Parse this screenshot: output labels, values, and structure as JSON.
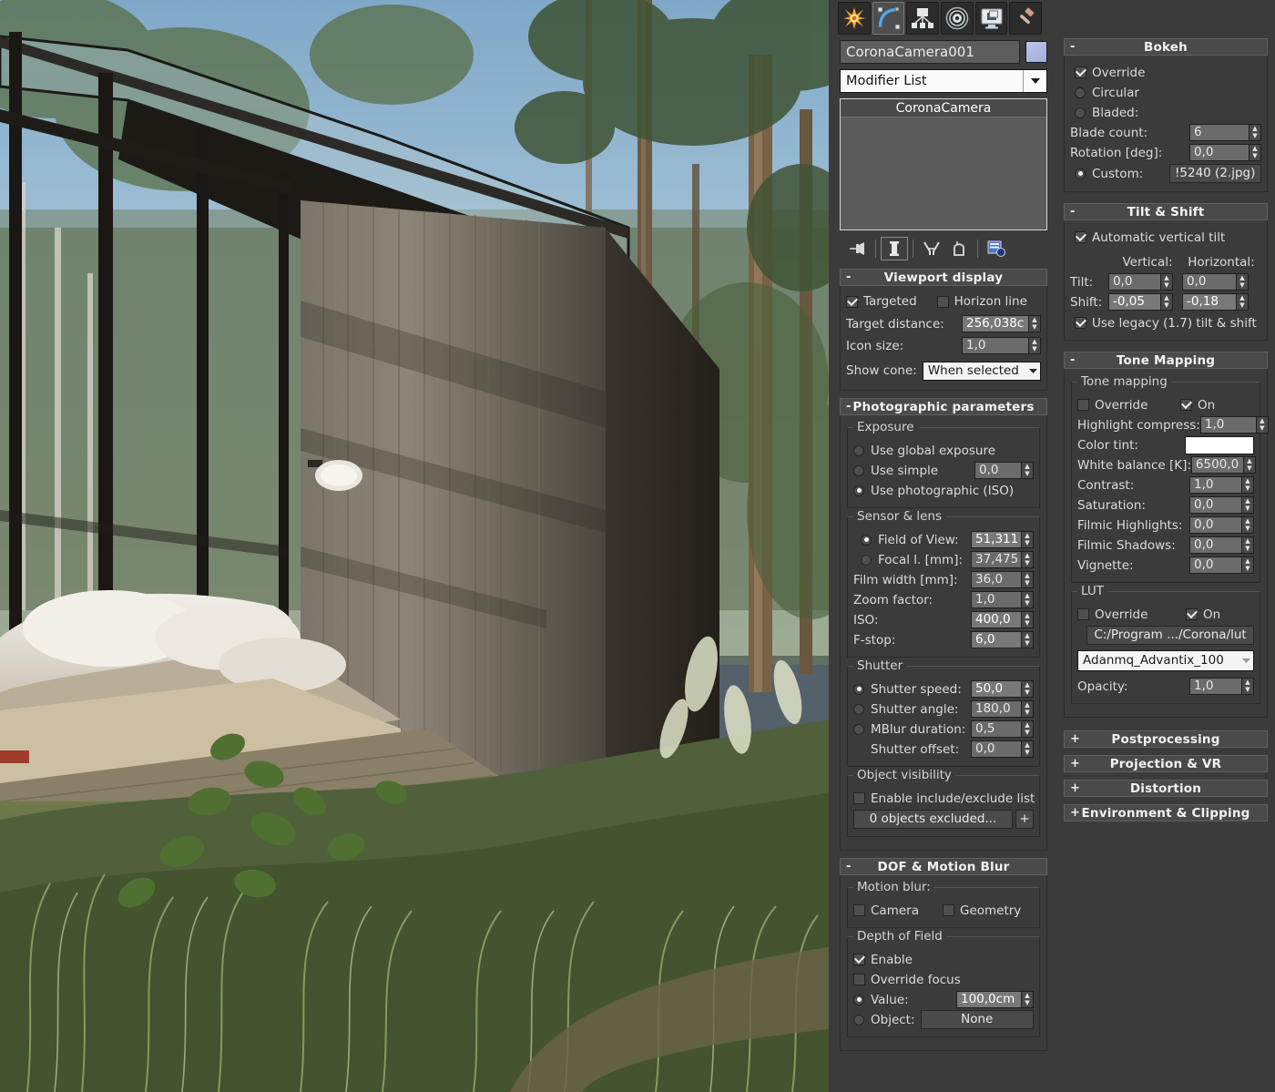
{
  "app": {
    "panel_title": "3ds Max Command Panel - Modify",
    "tabs": [
      {
        "name": "create-tab",
        "icon": "star-create-icon",
        "active": false
      },
      {
        "name": "modify-tab",
        "icon": "curve-modify-icon",
        "active": true
      },
      {
        "name": "hierarchy-tab",
        "icon": "hierarchy-icon",
        "active": false
      },
      {
        "name": "motion-tab",
        "icon": "motion-wheel-icon",
        "active": false
      },
      {
        "name": "display-tab",
        "icon": "display-monitor-icon",
        "active": false
      },
      {
        "name": "utilities-tab",
        "icon": "hammer-utilities-icon",
        "active": false
      }
    ]
  },
  "object": {
    "name_value": "CoronaCamera001",
    "modifier_list_value": "Modifier List",
    "stack_items": [
      "CoronaCamera"
    ],
    "stack_tools": [
      {
        "name": "pin-stack-icon"
      },
      {
        "name": "show-end-result-icon"
      },
      {
        "name": "make-unique-icon"
      },
      {
        "name": "remove-modifier-icon"
      },
      {
        "name": "configure-modifier-sets-icon"
      }
    ]
  },
  "viewport_display": {
    "title": "Viewport display",
    "targeted_label": "Targeted",
    "targeted_checked": true,
    "horizon_label": "Horizon line",
    "horizon_checked": false,
    "target_distance_label": "Target distance:",
    "target_distance_value": "256,038c",
    "icon_size_label": "Icon size:",
    "icon_size_value": "1,0",
    "show_cone_label": "Show cone:",
    "show_cone_value": "When selected"
  },
  "photographic": {
    "title": "Photographic parameters",
    "exposure_group": "Exposure",
    "use_global_label": "Use global exposure",
    "use_simple_label": "Use simple",
    "use_simple_value": "0,0",
    "use_photographic_label": "Use photographic (ISO)",
    "exposure_selected": "photographic",
    "sensor_group": "Sensor & lens",
    "fov_label": "Field of View:",
    "fov_value": "51,311",
    "focal_label": "Focal l. [mm]:",
    "focal_value": "37,475",
    "lens_selected": "fov",
    "film_width_label": "Film width [mm]:",
    "film_width_value": "36,0",
    "zoom_factor_label": "Zoom factor:",
    "zoom_factor_value": "1,0",
    "iso_label": "ISO:",
    "iso_value": "400,0",
    "fstop_label": "F-stop:",
    "fstop_value": "6,0",
    "shutter_group": "Shutter",
    "shutter_speed_label": "Shutter speed:",
    "shutter_speed_value": "50,0",
    "shutter_angle_label": "Shutter angle:",
    "shutter_angle_value": "180,0",
    "mblur_label": "MBlur duration:",
    "mblur_value": "0,5",
    "shutter_offset_label": "Shutter offset:",
    "shutter_offset_value": "0,0",
    "shutter_selected": "speed",
    "object_visibility_group": "Object visibility",
    "enable_list_label": "Enable include/exclude list",
    "enable_list_checked": false,
    "excluded_label": "0 objects excluded...",
    "excluded_plus": "+"
  },
  "dof": {
    "title": "DOF & Motion Blur",
    "motion_blur_group": "Motion blur:",
    "camera_label": "Camera",
    "camera_checked": false,
    "geometry_label": "Geometry",
    "geometry_checked": false,
    "depth_group": "Depth of Field",
    "enable_label": "Enable",
    "enable_checked": true,
    "override_focus_label": "Override focus",
    "override_focus_checked": false,
    "value_label": "Value:",
    "value_value": "100,0cm",
    "object_label": "Object:",
    "object_value": "None",
    "focus_selected": "value"
  },
  "bokeh": {
    "title": "Bokeh",
    "override_label": "Override",
    "override_checked": true,
    "circular_label": "Circular",
    "bladed_label": "Bladed:",
    "blade_count_label": "Blade count:",
    "blade_count_value": "6",
    "rotation_label": "Rotation [deg]:",
    "rotation_value": "0,0",
    "custom_label": "Custom:",
    "custom_value": "!5240 (2.jpg)",
    "shape_selected": "custom"
  },
  "tilt_shift": {
    "title": "Tilt & Shift",
    "auto_tilt_label": "Automatic vertical tilt",
    "auto_tilt_checked": true,
    "vertical_header": "Vertical:",
    "horizontal_header": "Horizontal:",
    "tilt_label": "Tilt:",
    "tilt_vertical": "0,0",
    "tilt_horizontal": "0,0",
    "shift_label": "Shift:",
    "shift_vertical": "-0,05",
    "shift_horizontal": "-0,18",
    "legacy_label": "Use legacy (1.7) tilt & shift",
    "legacy_checked": true
  },
  "tone_mapping": {
    "title": "Tone Mapping",
    "group_label": "Tone mapping",
    "override_label": "Override",
    "override_checked": false,
    "on_label": "On",
    "on_checked": true,
    "highlight_label": "Highlight compress:",
    "highlight_value": "1,0",
    "color_tint_label": "Color tint:",
    "color_tint_color": "#ffffff",
    "white_balance_label": "White balance [K]:",
    "white_balance_value": "6500,0",
    "contrast_label": "Contrast:",
    "contrast_value": "1,0",
    "saturation_label": "Saturation:",
    "saturation_value": "0,0",
    "filmic_high_label": "Filmic Highlights:",
    "filmic_high_value": "0,0",
    "filmic_shadow_label": "Filmic Shadows:",
    "filmic_shadow_value": "0,0",
    "vignette_label": "Vignette:",
    "vignette_value": "0,0",
    "lut_group": "LUT",
    "lut_override_label": "Override",
    "lut_override_checked": false,
    "lut_on_label": "On",
    "lut_on_checked": true,
    "lut_path": "C:/Program .../Corona/lut",
    "lut_file": "Adanmq_Advantix_100",
    "opacity_label": "Opacity:",
    "opacity_value": "1,0"
  },
  "collapsed_rollouts": [
    {
      "label": "Postprocessing",
      "sign": "+"
    },
    {
      "label": "Projection & VR",
      "sign": "+"
    },
    {
      "label": "Distortion",
      "sign": "+"
    },
    {
      "label": "Environment & Clipping",
      "sign": "+"
    }
  ],
  "viewport_scene": {
    "description": "Rendered 3D architectural scene: dark wood cabin with glass canopy, bed, forest of pine and birch trees, tall grass in foreground, blue sky"
  }
}
